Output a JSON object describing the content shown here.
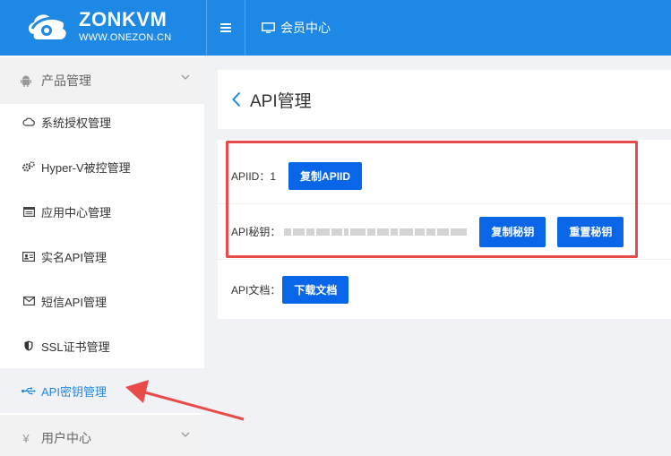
{
  "header": {
    "brand": "ZONKVM",
    "site": "WWW.ONEZON.CN",
    "menu_icon": "hamburger-icon",
    "member_center": "会员中心",
    "member_icon": "monitor-icon",
    "bg_color": "#1e88e5"
  },
  "sidebar": {
    "groups": [
      {
        "label": "产品管理",
        "icon": "android-icon"
      },
      {
        "label": "用户中心",
        "icon": "yen-icon"
      }
    ],
    "items": [
      {
        "label": "系统授权管理",
        "icon": "cloud-icon"
      },
      {
        "label": "Hyper-V被控管理",
        "icon": "gears-icon"
      },
      {
        "label": "应用中心管理",
        "icon": "window-icon"
      },
      {
        "label": "实名API管理",
        "icon": "id-card-icon"
      },
      {
        "label": "短信API管理",
        "icon": "envelope-icon"
      },
      {
        "label": "SSL证书管理",
        "icon": "shield-icon"
      },
      {
        "label": "API密钥管理",
        "icon": "usb-icon",
        "active": true
      }
    ],
    "active_color": "#1e88e5"
  },
  "page": {
    "title": "API管理",
    "back_icon": "chevron-left-icon"
  },
  "api": {
    "apiid_label": "APIID：",
    "apiid_value": "1",
    "copy_apiid": "复制APIID",
    "secret_label": "API秘钥：",
    "copy_secret": "复制秘钥",
    "reset_secret": "重置秘钥",
    "doc_label": "API文档：",
    "download_doc": "下载文档",
    "button_color": "#0a66e8"
  },
  "annotation": {
    "box_color": "#e84a4a",
    "arrow_color": "#e84a4a"
  }
}
